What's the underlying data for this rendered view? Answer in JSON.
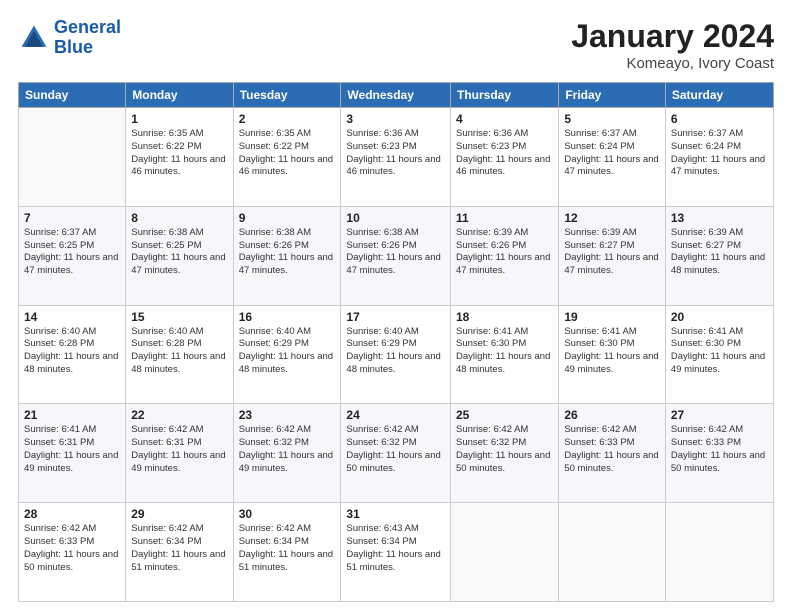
{
  "header": {
    "logo_line1": "General",
    "logo_line2": "Blue",
    "title": "January 2024",
    "subtitle": "Komeayo, Ivory Coast"
  },
  "weekdays": [
    "Sunday",
    "Monday",
    "Tuesday",
    "Wednesday",
    "Thursday",
    "Friday",
    "Saturday"
  ],
  "weeks": [
    [
      {
        "day": "",
        "sunrise": "",
        "sunset": "",
        "daylight": ""
      },
      {
        "day": "1",
        "sunrise": "Sunrise: 6:35 AM",
        "sunset": "Sunset: 6:22 PM",
        "daylight": "Daylight: 11 hours and 46 minutes."
      },
      {
        "day": "2",
        "sunrise": "Sunrise: 6:35 AM",
        "sunset": "Sunset: 6:22 PM",
        "daylight": "Daylight: 11 hours and 46 minutes."
      },
      {
        "day": "3",
        "sunrise": "Sunrise: 6:36 AM",
        "sunset": "Sunset: 6:23 PM",
        "daylight": "Daylight: 11 hours and 46 minutes."
      },
      {
        "day": "4",
        "sunrise": "Sunrise: 6:36 AM",
        "sunset": "Sunset: 6:23 PM",
        "daylight": "Daylight: 11 hours and 46 minutes."
      },
      {
        "day": "5",
        "sunrise": "Sunrise: 6:37 AM",
        "sunset": "Sunset: 6:24 PM",
        "daylight": "Daylight: 11 hours and 47 minutes."
      },
      {
        "day": "6",
        "sunrise": "Sunrise: 6:37 AM",
        "sunset": "Sunset: 6:24 PM",
        "daylight": "Daylight: 11 hours and 47 minutes."
      }
    ],
    [
      {
        "day": "7",
        "sunrise": "Sunrise: 6:37 AM",
        "sunset": "Sunset: 6:25 PM",
        "daylight": "Daylight: 11 hours and 47 minutes."
      },
      {
        "day": "8",
        "sunrise": "Sunrise: 6:38 AM",
        "sunset": "Sunset: 6:25 PM",
        "daylight": "Daylight: 11 hours and 47 minutes."
      },
      {
        "day": "9",
        "sunrise": "Sunrise: 6:38 AM",
        "sunset": "Sunset: 6:26 PM",
        "daylight": "Daylight: 11 hours and 47 minutes."
      },
      {
        "day": "10",
        "sunrise": "Sunrise: 6:38 AM",
        "sunset": "Sunset: 6:26 PM",
        "daylight": "Daylight: 11 hours and 47 minutes."
      },
      {
        "day": "11",
        "sunrise": "Sunrise: 6:39 AM",
        "sunset": "Sunset: 6:26 PM",
        "daylight": "Daylight: 11 hours and 47 minutes."
      },
      {
        "day": "12",
        "sunrise": "Sunrise: 6:39 AM",
        "sunset": "Sunset: 6:27 PM",
        "daylight": "Daylight: 11 hours and 47 minutes."
      },
      {
        "day": "13",
        "sunrise": "Sunrise: 6:39 AM",
        "sunset": "Sunset: 6:27 PM",
        "daylight": "Daylight: 11 hours and 48 minutes."
      }
    ],
    [
      {
        "day": "14",
        "sunrise": "Sunrise: 6:40 AM",
        "sunset": "Sunset: 6:28 PM",
        "daylight": "Daylight: 11 hours and 48 minutes."
      },
      {
        "day": "15",
        "sunrise": "Sunrise: 6:40 AM",
        "sunset": "Sunset: 6:28 PM",
        "daylight": "Daylight: 11 hours and 48 minutes."
      },
      {
        "day": "16",
        "sunrise": "Sunrise: 6:40 AM",
        "sunset": "Sunset: 6:29 PM",
        "daylight": "Daylight: 11 hours and 48 minutes."
      },
      {
        "day": "17",
        "sunrise": "Sunrise: 6:40 AM",
        "sunset": "Sunset: 6:29 PM",
        "daylight": "Daylight: 11 hours and 48 minutes."
      },
      {
        "day": "18",
        "sunrise": "Sunrise: 6:41 AM",
        "sunset": "Sunset: 6:30 PM",
        "daylight": "Daylight: 11 hours and 48 minutes."
      },
      {
        "day": "19",
        "sunrise": "Sunrise: 6:41 AM",
        "sunset": "Sunset: 6:30 PM",
        "daylight": "Daylight: 11 hours and 49 minutes."
      },
      {
        "day": "20",
        "sunrise": "Sunrise: 6:41 AM",
        "sunset": "Sunset: 6:30 PM",
        "daylight": "Daylight: 11 hours and 49 minutes."
      }
    ],
    [
      {
        "day": "21",
        "sunrise": "Sunrise: 6:41 AM",
        "sunset": "Sunset: 6:31 PM",
        "daylight": "Daylight: 11 hours and 49 minutes."
      },
      {
        "day": "22",
        "sunrise": "Sunrise: 6:42 AM",
        "sunset": "Sunset: 6:31 PM",
        "daylight": "Daylight: 11 hours and 49 minutes."
      },
      {
        "day": "23",
        "sunrise": "Sunrise: 6:42 AM",
        "sunset": "Sunset: 6:32 PM",
        "daylight": "Daylight: 11 hours and 49 minutes."
      },
      {
        "day": "24",
        "sunrise": "Sunrise: 6:42 AM",
        "sunset": "Sunset: 6:32 PM",
        "daylight": "Daylight: 11 hours and 50 minutes."
      },
      {
        "day": "25",
        "sunrise": "Sunrise: 6:42 AM",
        "sunset": "Sunset: 6:32 PM",
        "daylight": "Daylight: 11 hours and 50 minutes."
      },
      {
        "day": "26",
        "sunrise": "Sunrise: 6:42 AM",
        "sunset": "Sunset: 6:33 PM",
        "daylight": "Daylight: 11 hours and 50 minutes."
      },
      {
        "day": "27",
        "sunrise": "Sunrise: 6:42 AM",
        "sunset": "Sunset: 6:33 PM",
        "daylight": "Daylight: 11 hours and 50 minutes."
      }
    ],
    [
      {
        "day": "28",
        "sunrise": "Sunrise: 6:42 AM",
        "sunset": "Sunset: 6:33 PM",
        "daylight": "Daylight: 11 hours and 50 minutes."
      },
      {
        "day": "29",
        "sunrise": "Sunrise: 6:42 AM",
        "sunset": "Sunset: 6:34 PM",
        "daylight": "Daylight: 11 hours and 51 minutes."
      },
      {
        "day": "30",
        "sunrise": "Sunrise: 6:42 AM",
        "sunset": "Sunset: 6:34 PM",
        "daylight": "Daylight: 11 hours and 51 minutes."
      },
      {
        "day": "31",
        "sunrise": "Sunrise: 6:43 AM",
        "sunset": "Sunset: 6:34 PM",
        "daylight": "Daylight: 11 hours and 51 minutes."
      },
      {
        "day": "",
        "sunrise": "",
        "sunset": "",
        "daylight": ""
      },
      {
        "day": "",
        "sunrise": "",
        "sunset": "",
        "daylight": ""
      },
      {
        "day": "",
        "sunrise": "",
        "sunset": "",
        "daylight": ""
      }
    ]
  ]
}
